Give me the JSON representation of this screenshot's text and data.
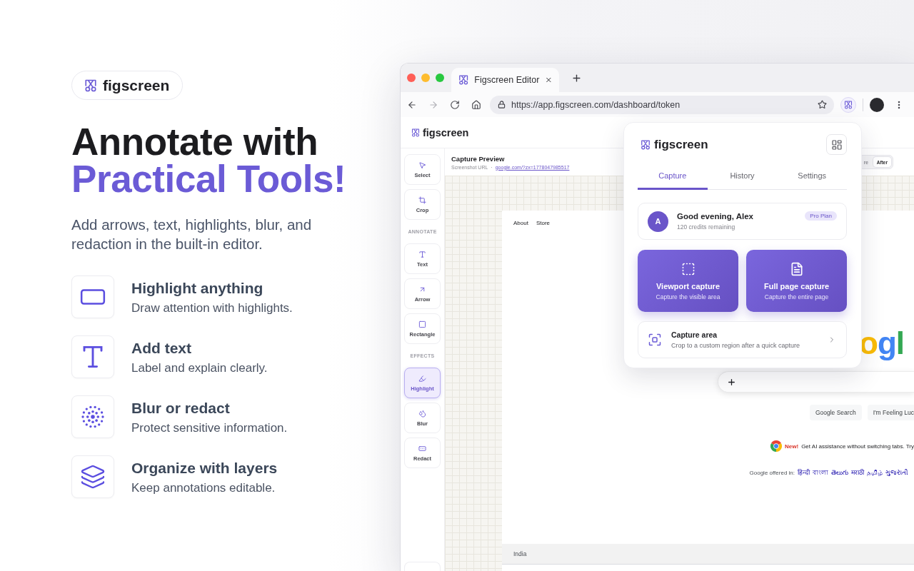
{
  "brand": {
    "name": "figscreen"
  },
  "headline": {
    "text": "Annotate with",
    "accent": "Practical Tools!"
  },
  "subtitle": "Add arrows, text, highlights, blur, and redaction in the built-in editor.",
  "features": [
    {
      "title": "Highlight anything",
      "description": "Draw attention with highlights."
    },
    {
      "title": "Add text",
      "description": "Label and explain clearly."
    },
    {
      "title": "Blur or redact",
      "description": "Protect sensitive information."
    },
    {
      "title": "Organize with layers",
      "description": "Keep annotations editable."
    }
  ],
  "browser": {
    "tabs": [
      {
        "title": "Figscreen Editor",
        "selected": true
      }
    ],
    "address": "https://app.figscreen.com/dashboard/token"
  },
  "editor": {
    "brand": "figscreen",
    "tools": [
      {
        "kind": "tool",
        "label": "Select",
        "selected": false
      },
      {
        "kind": "tool",
        "label": "Crop",
        "selected": false
      },
      {
        "kind": "section",
        "label": "ANNOTATE"
      },
      {
        "kind": "tool",
        "label": "Text",
        "selected": false
      },
      {
        "kind": "tool",
        "label": "Arrow",
        "selected": false
      },
      {
        "kind": "tool",
        "label": "Rectangle",
        "selected": false
      },
      {
        "kind": "section",
        "label": "EFFECTS"
      },
      {
        "kind": "tool",
        "label": "Highlight",
        "selected": true
      },
      {
        "kind": "tool",
        "label": "Blur",
        "selected": false
      },
      {
        "kind": "tool",
        "label": "Redact",
        "selected": false
      }
    ],
    "preview": {
      "title": "Capture Preview",
      "url_label": "Screenshot URL",
      "separator": "·",
      "url": "google.com/?zx=1778047985517",
      "view_toggle": [
        {
          "label": "re",
          "selected": false
        },
        {
          "label": "After",
          "selected": true
        }
      ]
    }
  },
  "captured_page": {
    "nav": [
      "About",
      "Store"
    ],
    "logo": "ogl",
    "buttons": [
      "Google Search",
      "I'm Feeling Luc"
    ],
    "promo": {
      "badge": "New!",
      "text": "Get AI assistance without switching tabs. Try"
    },
    "offered_in": "Google offered in:",
    "languages": [
      "हिन्दी",
      "বাংলা",
      "తెలుగు",
      "मराठी",
      "தமிழ்",
      "ગુજરાતી"
    ],
    "footer": "India"
  },
  "popup": {
    "brand": "figscreen",
    "tabs": [
      {
        "label": "Capture",
        "selected": true
      },
      {
        "label": "History",
        "selected": false
      },
      {
        "label": "Settings",
        "selected": false
      }
    ],
    "user": {
      "initial": "A",
      "greeting": "Good evening, Alex",
      "credits": "120 credits remaining",
      "plan": "Pro Plan"
    },
    "actions": [
      {
        "title": "Viewport capture",
        "subtitle": "Capture the visible area"
      },
      {
        "title": "Full page capture",
        "subtitle": "Capture the entire page"
      }
    ],
    "capture_area": {
      "title": "Capture area",
      "subtitle": "Crop to a custom region after a quick capture"
    }
  }
}
